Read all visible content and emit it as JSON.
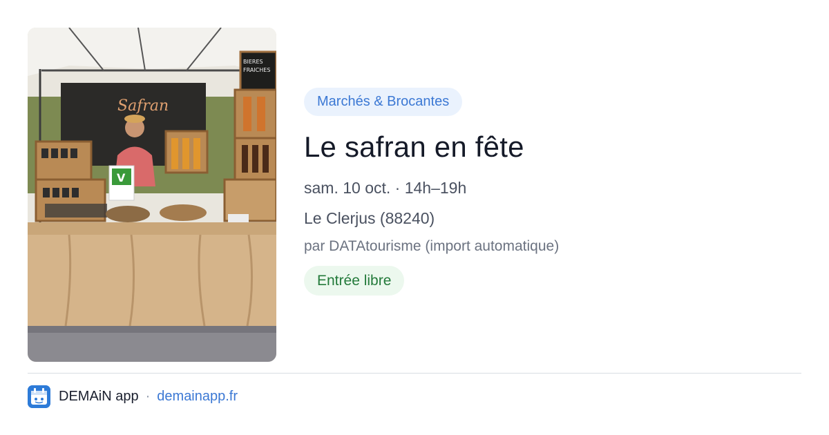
{
  "event": {
    "category": "Marchés & Brocantes",
    "title": "Le safran en fête",
    "datetime": "sam. 10 oct. · 14h–19h",
    "location": "Le Clerjus (88240)",
    "organizer": "par DATAtourisme (import automatique)",
    "price": "Entrée libre"
  },
  "footer": {
    "app_name": "DEMAiN app",
    "separator": "·",
    "url": "demainapp.fr"
  },
  "photo": {
    "sign_text": "Safran",
    "chalkboard_text": "BIERES SAFRAN FRAICHES",
    "label_text": "V"
  },
  "colors": {
    "category_bg": "#eaf2fd",
    "category_text": "#3b78d4",
    "price_bg": "#ecf8ee",
    "price_text": "#237a3a",
    "brand": "#2d7bd8"
  }
}
